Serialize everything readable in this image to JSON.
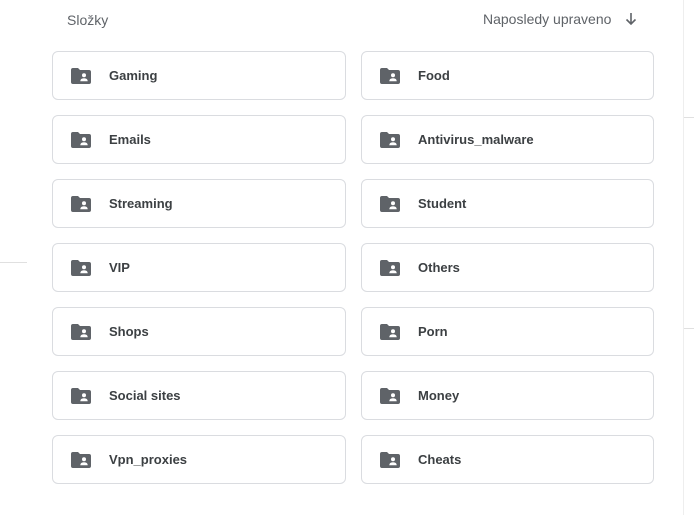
{
  "header": {
    "section_title": "Složky",
    "sort_label": "Naposledy upraveno",
    "sort_icon": "arrow-down-icon"
  },
  "folders": [
    {
      "name": "Gaming",
      "icon": "shared-folder-icon"
    },
    {
      "name": "Food",
      "icon": "shared-folder-icon"
    },
    {
      "name": "Emails",
      "icon": "shared-folder-icon"
    },
    {
      "name": "Antivirus_malware",
      "icon": "shared-folder-icon"
    },
    {
      "name": "Streaming",
      "icon": "shared-folder-icon"
    },
    {
      "name": "Student",
      "icon": "shared-folder-icon"
    },
    {
      "name": "VIP",
      "icon": "shared-folder-icon"
    },
    {
      "name": "Others",
      "icon": "shared-folder-icon"
    },
    {
      "name": "Shops",
      "icon": "shared-folder-icon"
    },
    {
      "name": "Porn",
      "icon": "shared-folder-icon"
    },
    {
      "name": "Social sites",
      "icon": "shared-folder-icon"
    },
    {
      "name": "Money",
      "icon": "shared-folder-icon"
    },
    {
      "name": "Vpn_proxies",
      "icon": "shared-folder-icon"
    },
    {
      "name": "Cheats",
      "icon": "shared-folder-icon"
    }
  ],
  "colors": {
    "icon": "#5f6368",
    "border": "#dadce0",
    "text": "#3c4043",
    "muted": "#5f6368"
  }
}
